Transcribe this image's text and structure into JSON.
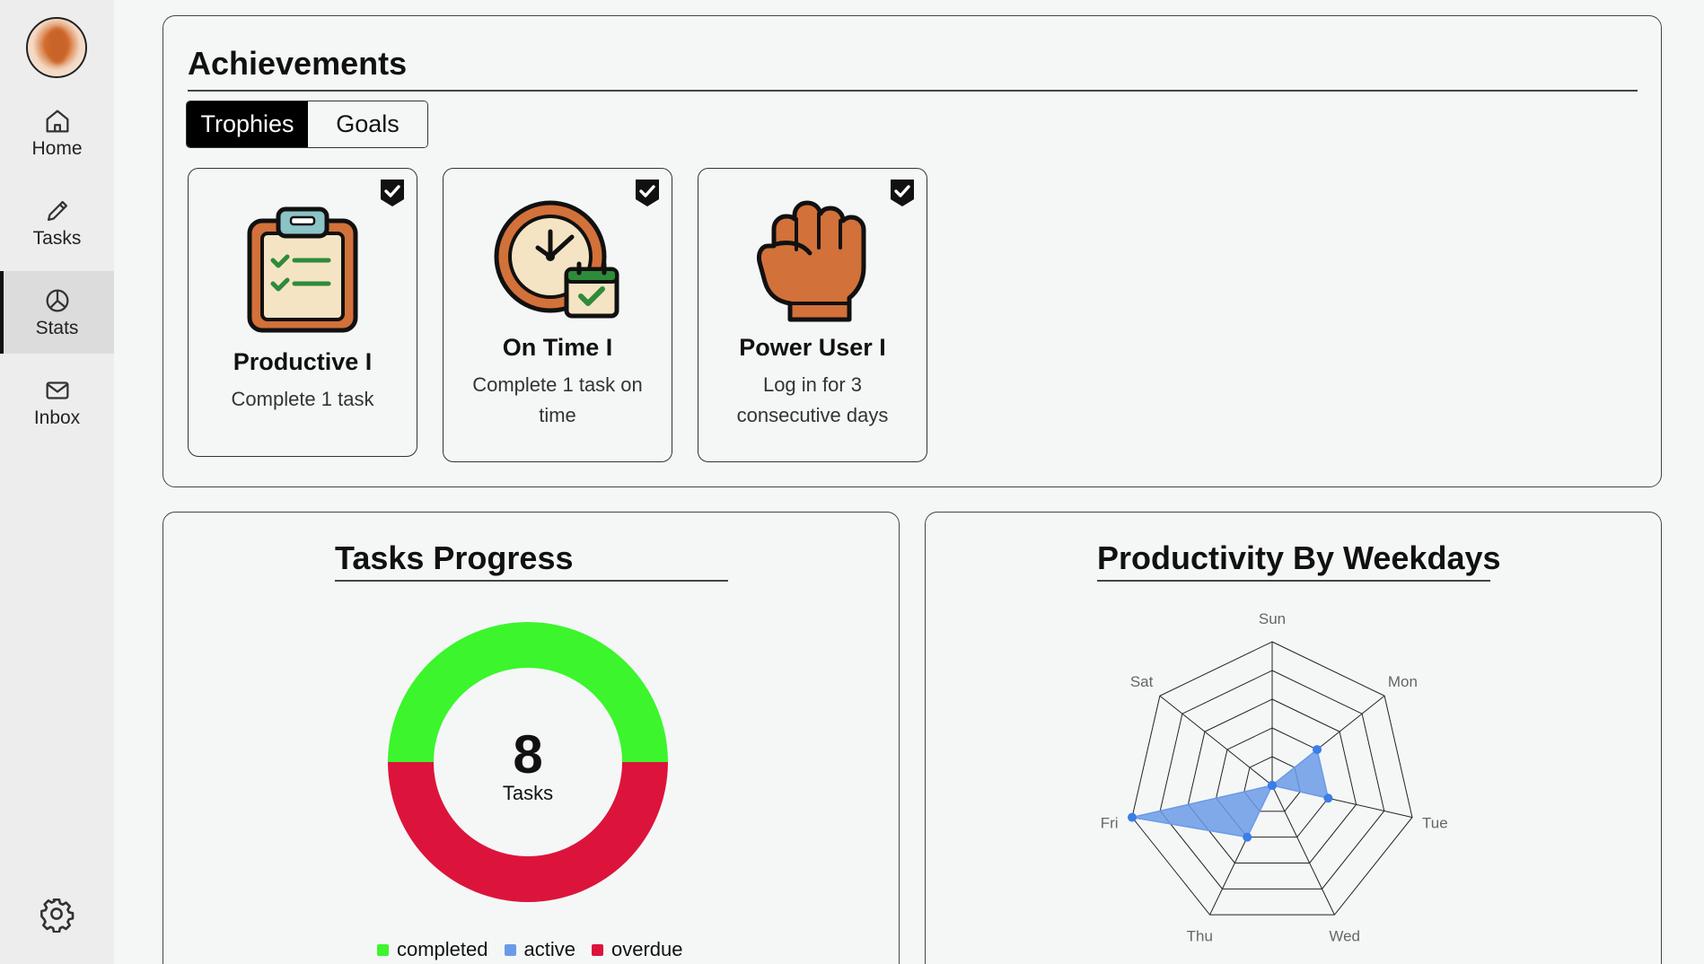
{
  "sidebar": {
    "items": [
      {
        "label": "Home",
        "icon": "home-icon",
        "active": false
      },
      {
        "label": "Tasks",
        "icon": "pencil-icon",
        "active": false
      },
      {
        "label": "Stats",
        "icon": "pie-chart-icon",
        "active": true
      },
      {
        "label": "Inbox",
        "icon": "mail-icon",
        "active": false
      }
    ],
    "settings_icon": "gear-icon"
  },
  "achievements": {
    "title": "Achievements",
    "tabs": [
      {
        "label": "Trophies",
        "selected": true
      },
      {
        "label": "Goals",
        "selected": false
      }
    ],
    "cards": [
      {
        "title": "Productive I",
        "description": "Complete 1 task",
        "icon": "clipboard-checklist-icon",
        "completed": true
      },
      {
        "title": "On Time I",
        "description": "Complete 1 task on time",
        "icon": "clock-calendar-icon",
        "completed": true
      },
      {
        "title": "Power User I",
        "description": "Log in for 3 consecutive days",
        "icon": "fist-icon",
        "completed": true
      }
    ]
  },
  "tasks_progress": {
    "title": "Tasks Progress",
    "total": "8",
    "total_label": "Tasks",
    "legend": [
      {
        "label": "completed",
        "color": "#3cf52d"
      },
      {
        "label": "active",
        "color": "#6b9be8"
      },
      {
        "label": "overdue",
        "color": "#dc143c"
      }
    ]
  },
  "productivity": {
    "title": "Productivity By Weekdays"
  },
  "chart_data": [
    {
      "type": "pie",
      "categories": [
        "completed",
        "active",
        "overdue"
      ],
      "values": [
        4,
        0,
        4
      ],
      "colors": [
        "#3cf52d",
        "#6b9be8",
        "#dc143c"
      ],
      "title": "Tasks Progress"
    },
    {
      "type": "radar",
      "title": "Productivity By Weekdays",
      "categories": [
        "Sun",
        "Mon",
        "Tue",
        "Wed",
        "Thu",
        "Fri",
        "Sat"
      ],
      "values": [
        0,
        2,
        2,
        0,
        2,
        5,
        0
      ],
      "rmax": 5,
      "rings": 5,
      "color": "#6b9be8"
    }
  ]
}
